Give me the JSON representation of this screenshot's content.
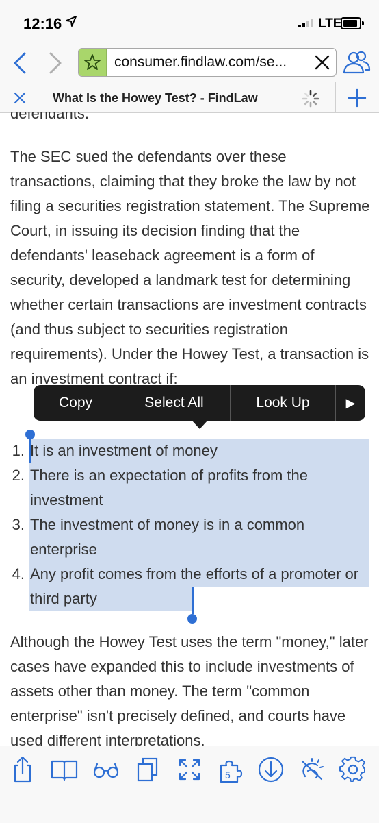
{
  "status_bar": {
    "time": "12:16",
    "network": "LTE"
  },
  "browser": {
    "url": "consumer.findlaw.com/se...",
    "tab_title": "What Is the Howey Test? - FindLaw",
    "accent_color": "#2e6fd4",
    "bookmark_star_bg": "#a9d66b"
  },
  "article": {
    "top_fragment": "defendants.",
    "paragraph_main": "The SEC sued the defendants over these transactions, claiming that they broke the law by not filing a securities registration statement. The Supreme Court, in issuing its decision finding that the defendants' leaseback agreement is a form of security, developed a landmark test for determining whether certain transactions are investment contracts (and thus subject to securities registration requirements). Under the Howey Test, a transaction is an investment contract if:",
    "list": [
      {
        "num": "1.",
        "text": "It is an investment of money"
      },
      {
        "num": "2.",
        "text": "There is an expectation of profits from the investment"
      },
      {
        "num": "3.",
        "text": "The investment of money is in a common enterprise"
      },
      {
        "num": "4.",
        "text": "Any profit comes from the efforts of a promoter or third party"
      }
    ],
    "paragraph_after": "Although the Howey Test uses the term \"money,\" later cases have expanded this to include investments of assets other than money. The term \"common enterprise\" isn't precisely defined, and courts have used different interpretations."
  },
  "context_menu": {
    "copy": "Copy",
    "select_all": "Select All",
    "look_up": "Look Up",
    "more_arrow": "▶"
  },
  "toolbar_icons": [
    "share-icon",
    "book-icon",
    "glasses-icon",
    "copy-icon",
    "expand-icon",
    "puzzle-icon",
    "download-icon",
    "night-mode-icon",
    "gear-icon"
  ]
}
